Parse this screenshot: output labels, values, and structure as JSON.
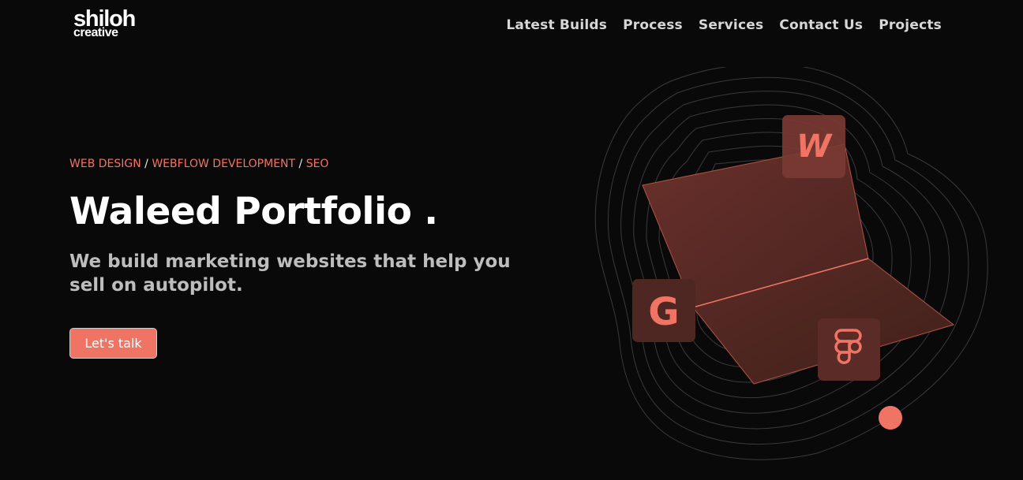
{
  "brand": {
    "name": "shiloh",
    "tagline": "creative"
  },
  "nav": {
    "items": [
      {
        "label": "Latest Builds"
      },
      {
        "label": "Process"
      },
      {
        "label": "Services"
      },
      {
        "label": "Contact Us"
      },
      {
        "label": "Projects"
      }
    ]
  },
  "hero": {
    "tags": [
      "WEB DESIGN",
      "WEBFLOW DEVELOPMENT",
      "SEO"
    ],
    "tag_separator": "/",
    "title": "Waleed Portfolio .",
    "subtitle": "We build marketing websites that help you sell on autopilot.",
    "cta_label": "Let's talk"
  },
  "illustration": {
    "icons": [
      {
        "name": "webflow-icon",
        "glyph": "W"
      },
      {
        "name": "google-icon",
        "glyph": "G"
      },
      {
        "name": "figma-icon"
      }
    ]
  },
  "colors": {
    "background": "#090909",
    "accent": "#f07464",
    "nav_text": "#d7d7d7",
    "subtitle_text": "#bdbdbd"
  }
}
